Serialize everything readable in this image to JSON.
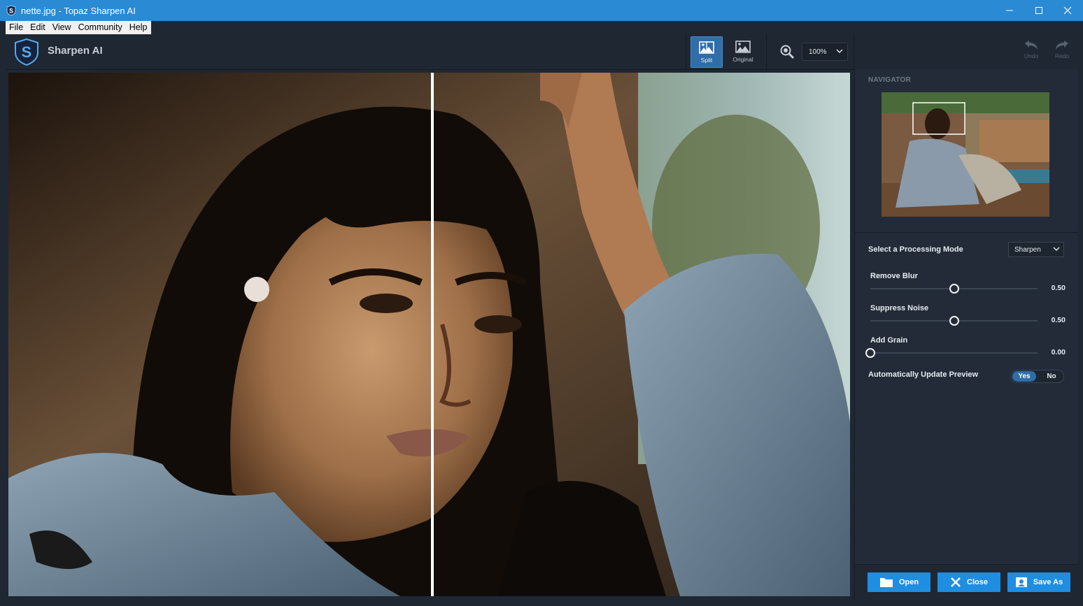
{
  "window": {
    "title": "nette.jpg - Topaz Sharpen AI",
    "minimize_symbol": "—",
    "close_symbol": "✕"
  },
  "menu": [
    "File",
    "Edit",
    "View",
    "Community",
    "Help"
  ],
  "toolbar": {
    "app_name": "Sharpen AI",
    "split_label": "Split",
    "original_label": "Original",
    "zoom_value": "100%",
    "undo_label": "Undo",
    "redo_label": "Redo"
  },
  "navigator": {
    "title": "NAVIGATOR"
  },
  "settings": {
    "mode_label": "Select a Processing Mode",
    "mode_value": "Sharpen",
    "sliders": [
      {
        "label": "Remove Blur",
        "value": "0.50",
        "fraction": 0.5
      },
      {
        "label": "Suppress Noise",
        "value": "0.50",
        "fraction": 0.5
      },
      {
        "label": "Add Grain",
        "value": "0.00",
        "fraction": 0.0
      }
    ],
    "auto_update_label": "Automatically Update Preview",
    "auto_update_yes": "Yes",
    "auto_update_no": "No"
  },
  "actions": {
    "open_label": "Open",
    "close_label": "Close",
    "save_as_label": "Save As"
  },
  "colors": {
    "titlebar": "#2a8ad4",
    "accent": "#1f8ee0",
    "panel_bg": "#222b37"
  }
}
